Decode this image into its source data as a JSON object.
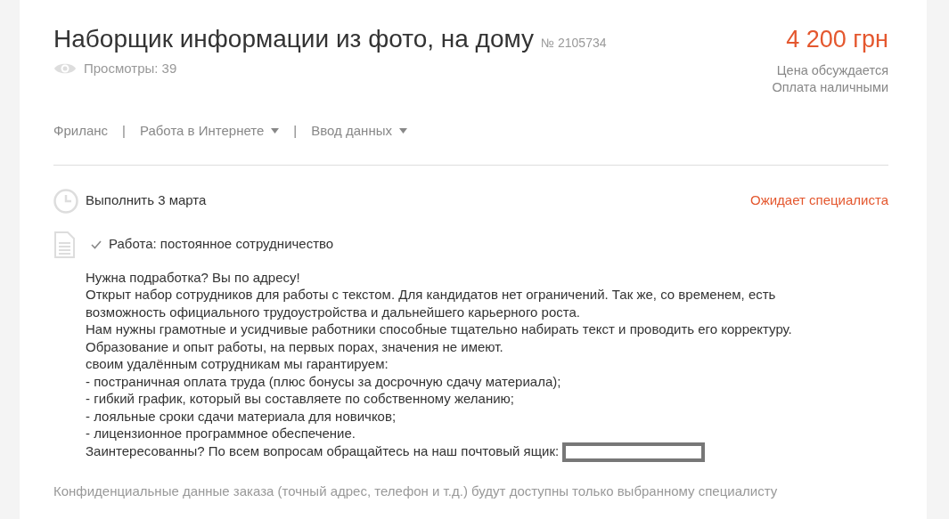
{
  "title": "Наборщик информации из фото, на дому",
  "number": "№ 2105734",
  "views": "Просмотры: 39",
  "price": "4 200 грн",
  "price_notes": [
    "Цена обсуждается",
    "Оплата наличными"
  ],
  "breadcrumbs": [
    {
      "label": "Фриланс",
      "dropdown": false
    },
    {
      "separator": "|",
      "label": "Работа в Интернете",
      "dropdown": true
    },
    {
      "separator": "|",
      "label": "Ввод данных",
      "dropdown": true
    }
  ],
  "deadline": "Выполнить 3 марта",
  "status": "Ожидает специалиста",
  "work_type": "Работа: постоянное сотрудничество",
  "description": [
    "Нужна подработка? Вы по адресу!",
    "Открыт набор сотрудников для работы с текстом. Для кандидатов нет ограничений. Так же, со временем, есть возможность официального трудоустройства и дальнейшего карьерного роста.",
    "Нам нужны грамотные и усидчивые работники способные тщательно набирать текст и проводить его корректуру.",
    "Образование и опыт работы, на первых порах, значения не имеют.",
    "своим удалённым сотрудникам мы гарантируем:",
    "- постраничная оплата труда (плюс бонусы за досрочную сдачу материала);",
    "- гибкий график, который вы составляете по собственному желанию;",
    "- лояльные сроки сдачи материала для новичков;",
    "- лицензионное программное обеспечение.",
    "Заинтересованны? По всем вопросам обращайтесь на наш почтовый ящик:"
  ],
  "footnote": "Конфиденциальные данные заказа (точный адрес, телефон и т.д.) будут доступны только выбранному специалисту"
}
